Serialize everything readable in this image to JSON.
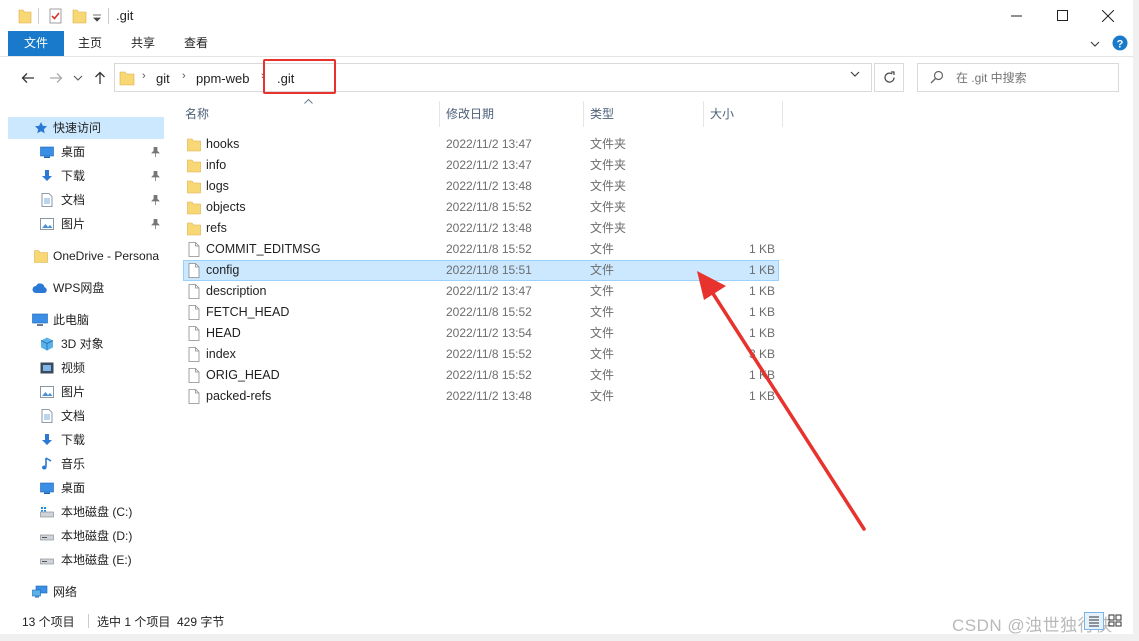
{
  "window": {
    "title": ".git",
    "controls": [
      "minimize",
      "maximize",
      "close"
    ]
  },
  "ribbon": {
    "tabs": [
      {
        "label": "文件",
        "active": true
      },
      {
        "label": "主页"
      },
      {
        "label": "共享"
      },
      {
        "label": "查看"
      }
    ]
  },
  "address": {
    "crumbs": [
      "git",
      "ppm-web",
      ".git"
    ],
    "search_placeholder": "在 .git 中搜索"
  },
  "nav": {
    "items": [
      {
        "label": "快速访问",
        "icon": "star-icon",
        "selected": true
      },
      {
        "label": "桌面",
        "icon": "desktop-icon",
        "pinned": true
      },
      {
        "label": "下载",
        "icon": "download-icon",
        "pinned": true
      },
      {
        "label": "文档",
        "icon": "document-icon",
        "pinned": true
      },
      {
        "label": "图片",
        "icon": "picture-icon",
        "pinned": true
      },
      {
        "label": "OneDrive - Persona",
        "icon": "folder-icon"
      },
      {
        "label": "WPS网盘",
        "icon": "cloud-icon"
      },
      {
        "label": "此电脑",
        "icon": "computer-icon"
      },
      {
        "label": "3D 对象",
        "icon": "cube-icon"
      },
      {
        "label": "视频",
        "icon": "video-icon"
      },
      {
        "label": "图片",
        "icon": "picture-icon"
      },
      {
        "label": "文档",
        "icon": "document-icon"
      },
      {
        "label": "下载",
        "icon": "download-icon"
      },
      {
        "label": "音乐",
        "icon": "music-icon"
      },
      {
        "label": "桌面",
        "icon": "desktop-icon"
      },
      {
        "label": "本地磁盘 (C:)",
        "icon": "drive-icon"
      },
      {
        "label": "本地磁盘 (D:)",
        "icon": "drive-icon"
      },
      {
        "label": "本地磁盘 (E:)",
        "icon": "drive-icon"
      },
      {
        "label": "网络",
        "icon": "network-icon"
      }
    ]
  },
  "columns": {
    "name": "名称",
    "modified": "修改日期",
    "type": "类型",
    "size": "大小"
  },
  "files": [
    {
      "name": "hooks",
      "modified": "2022/11/2 13:47",
      "type": "文件夹",
      "size": "",
      "kind": "folder"
    },
    {
      "name": "info",
      "modified": "2022/11/2 13:47",
      "type": "文件夹",
      "size": "",
      "kind": "folder"
    },
    {
      "name": "logs",
      "modified": "2022/11/2 13:48",
      "type": "文件夹",
      "size": "",
      "kind": "folder"
    },
    {
      "name": "objects",
      "modified": "2022/11/8 15:52",
      "type": "文件夹",
      "size": "",
      "kind": "folder"
    },
    {
      "name": "refs",
      "modified": "2022/11/2 13:48",
      "type": "文件夹",
      "size": "",
      "kind": "folder"
    },
    {
      "name": "COMMIT_EDITMSG",
      "modified": "2022/11/8 15:52",
      "type": "文件",
      "size": "1 KB",
      "kind": "file"
    },
    {
      "name": "config",
      "modified": "2022/11/8 15:51",
      "type": "文件",
      "size": "1 KB",
      "kind": "file",
      "selected": true
    },
    {
      "name": "description",
      "modified": "2022/11/2 13:47",
      "type": "文件",
      "size": "1 KB",
      "kind": "file"
    },
    {
      "name": "FETCH_HEAD",
      "modified": "2022/11/8 15:52",
      "type": "文件",
      "size": "1 KB",
      "kind": "file"
    },
    {
      "name": "HEAD",
      "modified": "2022/11/2 13:54",
      "type": "文件",
      "size": "1 KB",
      "kind": "file"
    },
    {
      "name": "index",
      "modified": "2022/11/8 15:52",
      "type": "文件",
      "size": "3 KB",
      "kind": "file"
    },
    {
      "name": "ORIG_HEAD",
      "modified": "2022/11/8 15:52",
      "type": "文件",
      "size": "1 KB",
      "kind": "file"
    },
    {
      "name": "packed-refs",
      "modified": "2022/11/2 13:48",
      "type": "文件",
      "size": "1 KB",
      "kind": "file"
    }
  ],
  "status": {
    "count": "13 个项目",
    "selection": "选中 1 个项目  429 字节"
  },
  "watermark": "CSDN @浊世独行侠",
  "colors": {
    "accent": "#1979ca",
    "selection": "#cce8ff",
    "annotation": "#e8322d",
    "folder": "#f8d775"
  }
}
